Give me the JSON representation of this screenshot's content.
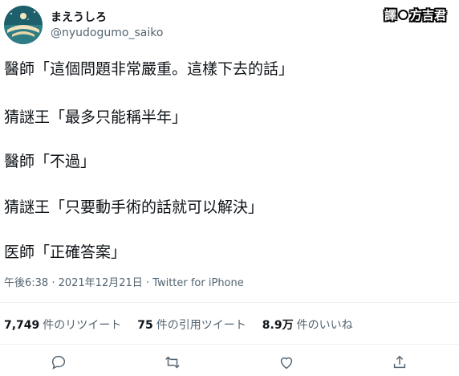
{
  "user": {
    "display_name": "まえうしろ",
    "handle": "@nyudogumo_saiko"
  },
  "translator_badge": {
    "prefix": "譯",
    "name": "方吉君"
  },
  "tweet_lines": [
    "醫師「這個問題非常嚴重。這樣下去的話」",
    "猜謎王「最多只能稱半年」",
    "醫師「不過」",
    "猜謎王「只要動手術的話就可以解決」",
    "医師「正確答案」"
  ],
  "meta": "午後6:38 · 2021年12月21日 · Twitter for iPhone",
  "stats": {
    "retweets": {
      "count": "7,749",
      "label": "件のリツイート"
    },
    "quotes": {
      "count": "75",
      "label": "件の引用ツイート"
    },
    "likes": {
      "count": "8.9万",
      "label": "件のいいね"
    }
  },
  "colors": {
    "text": "#0f1419",
    "secondary": "#536471",
    "divider": "#eff3f4"
  },
  "actions": [
    "reply-icon",
    "retweet-icon",
    "like-icon",
    "share-icon"
  ]
}
